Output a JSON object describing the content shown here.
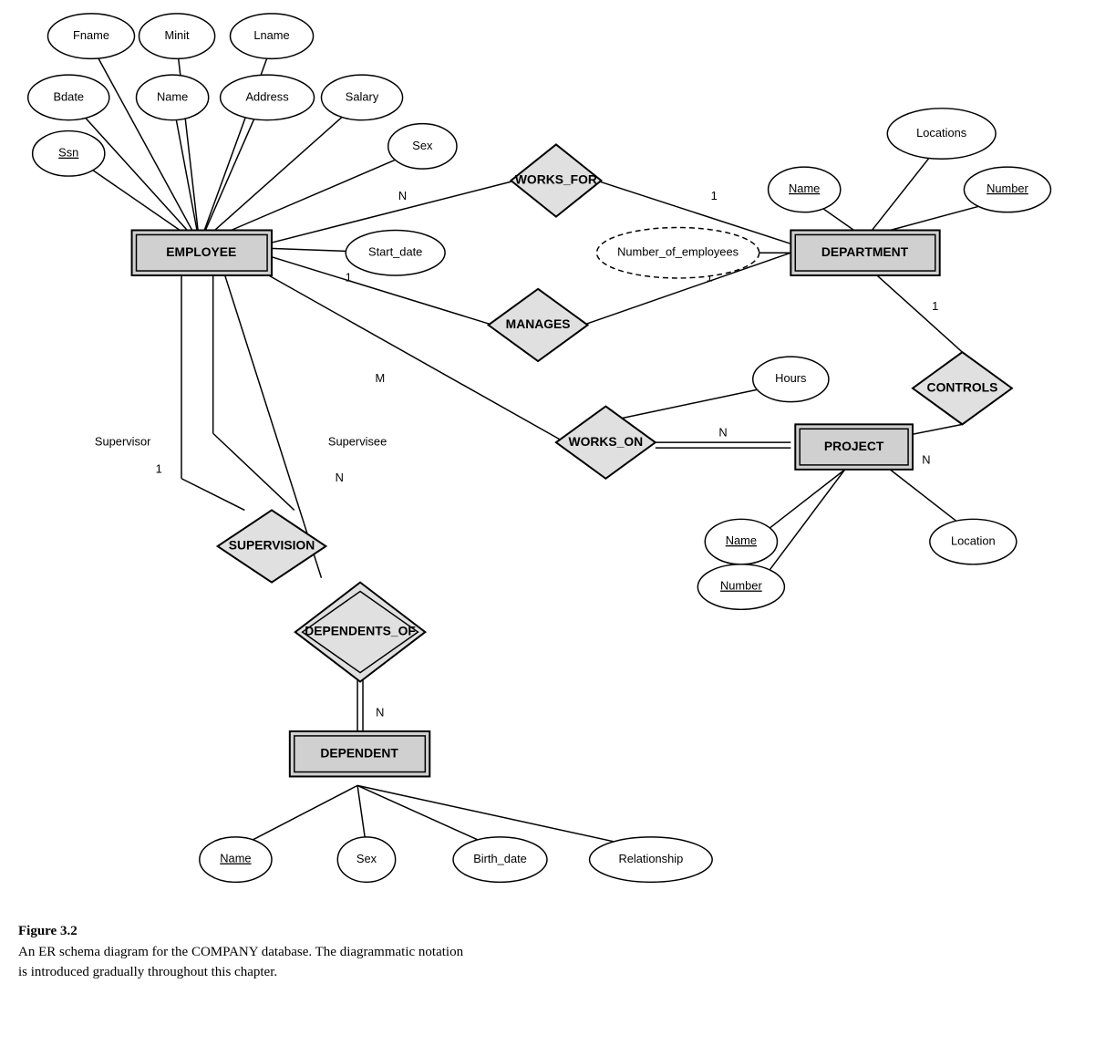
{
  "caption": {
    "title": "Figure 3.2",
    "line1": "An ER schema diagram for the COMPANY database. The diagrammatic notation",
    "line2": "is introduced gradually throughout this chapter."
  },
  "entities": {
    "employee": "EMPLOYEE",
    "department": "DEPARTMENT",
    "project": "PROJECT",
    "dependent": "DEPENDENT"
  },
  "relationships": {
    "works_for": "WORKS_FOR",
    "manages": "MANAGES",
    "works_on": "WORKS_ON",
    "controls": "CONTROLS",
    "supervision": "SUPERVISION",
    "dependents_of": "DEPENDENTS_OF"
  },
  "attributes": {
    "fname": "Fname",
    "minit": "Minit",
    "lname": "Lname",
    "bdate": "Bdate",
    "name_emp": "Name",
    "address": "Address",
    "salary": "Salary",
    "ssn": "Ssn",
    "sex_emp": "Sex",
    "start_date": "Start_date",
    "num_employees": "Number_of_employees",
    "locations": "Locations",
    "dept_name": "Name",
    "dept_number": "Number",
    "hours": "Hours",
    "proj_name": "Name",
    "proj_number": "Number",
    "location": "Location",
    "dep_name": "Name",
    "dep_sex": "Sex",
    "birth_date": "Birth_date",
    "relationship": "Relationship"
  }
}
